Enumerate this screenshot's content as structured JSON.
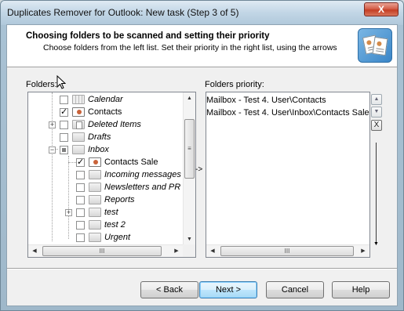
{
  "window": {
    "title": "Duplicates Remover for Outlook: New task (Step 3 of 5)",
    "close_label": "X"
  },
  "header": {
    "title": "Choosing folders to be scanned and setting their priority",
    "subtitle": "Choose folders from the left list. Set their priority in the right list, using the arrows",
    "icon": "contacts-documents-icon"
  },
  "folders": {
    "label": "Folders:",
    "items": [
      {
        "label": "Calendar",
        "checked": false,
        "italic": true,
        "icon": "calendar-folder-icon"
      },
      {
        "label": "Contacts",
        "checked": true,
        "italic": false,
        "icon": "contacts-folder-icon"
      },
      {
        "label": "Deleted Items",
        "checked": false,
        "italic": true,
        "icon": "deleted-items-icon"
      },
      {
        "label": "Drafts",
        "checked": false,
        "italic": true,
        "icon": "folder-icon"
      },
      {
        "label": "Inbox",
        "checked": false,
        "italic": true,
        "icon": "folder-icon"
      },
      {
        "label": "Contacts Sale",
        "checked": true,
        "italic": false,
        "icon": "contacts-folder-icon"
      },
      {
        "label": "Incoming messages",
        "checked": false,
        "italic": true,
        "icon": "folder-icon"
      },
      {
        "label": "Newsletters and PR",
        "checked": false,
        "italic": true,
        "icon": "folder-icon"
      },
      {
        "label": "Reports",
        "checked": false,
        "italic": true,
        "icon": "folder-icon"
      },
      {
        "label": "test",
        "checked": false,
        "italic": true,
        "icon": "folder-icon"
      },
      {
        "label": "test 2",
        "checked": false,
        "italic": true,
        "icon": "folder-icon"
      },
      {
        "label": "Urgent",
        "checked": false,
        "italic": true,
        "icon": "folder-icon"
      }
    ],
    "scroll_thumb_grip": "≡",
    "hscroll_grip": "III"
  },
  "transfer_arrow": "->",
  "priority": {
    "label": "Folders priority:",
    "items": [
      "Mailbox - Test 4. User\\Contacts",
      "Mailbox - Test 4. User\\Inbox\\Contacts Sale"
    ],
    "hscroll_grip": "III",
    "remove_label": "X"
  },
  "buttons": {
    "back": "< Back",
    "next": "Next >",
    "cancel": "Cancel",
    "help": "Help"
  }
}
